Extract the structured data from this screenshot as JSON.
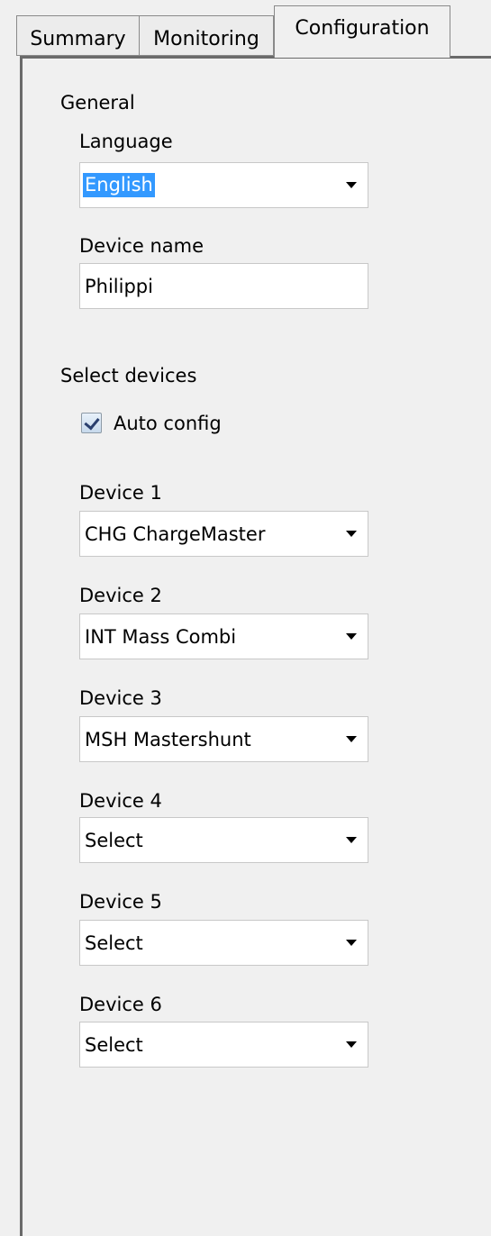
{
  "tabs": [
    {
      "label": "Summary",
      "active": false
    },
    {
      "label": "Monitoring",
      "active": false
    },
    {
      "label": "Configuration",
      "active": true
    }
  ],
  "general": {
    "legend": "General",
    "language_label": "Language",
    "language_value": "English",
    "device_name_label": "Device name",
    "device_name_value": "Philippi"
  },
  "devices": {
    "legend": "Select devices",
    "auto_config_label": "Auto config",
    "auto_config_checked": true,
    "items": [
      {
        "label": "Device 1",
        "value": "CHG ChargeMaster"
      },
      {
        "label": "Device 2",
        "value": "INT Mass Combi"
      },
      {
        "label": "Device 3",
        "value": "MSH Mastershunt"
      },
      {
        "label": "Device 4",
        "value": "Select"
      },
      {
        "label": "Device 5",
        "value": "Select"
      },
      {
        "label": "Device 6",
        "value": "Select"
      }
    ]
  },
  "icons": {
    "dropdown": "chevron-down-icon",
    "checkbox": "checkmark-icon"
  },
  "colors": {
    "selection": "#3399ff",
    "background": "#f0f0f0"
  }
}
